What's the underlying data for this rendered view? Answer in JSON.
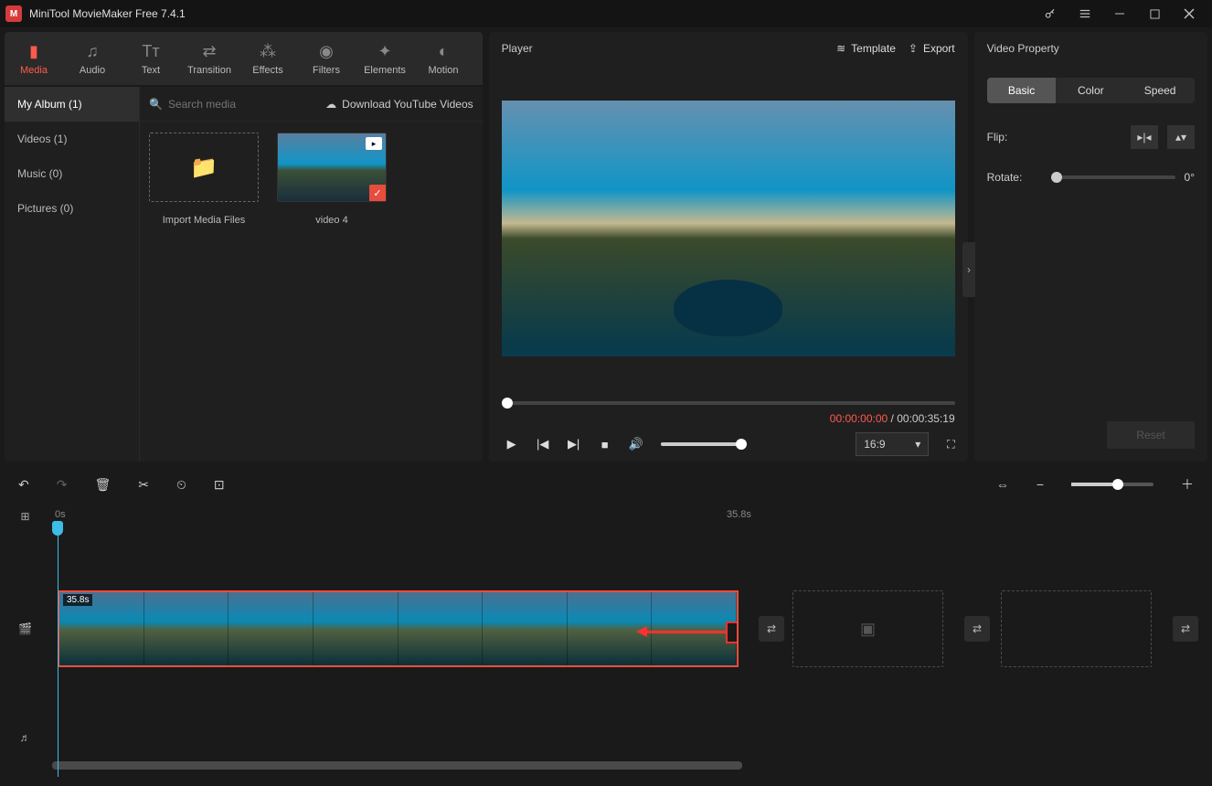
{
  "app": {
    "title": "MiniTool MovieMaker Free 7.4.1"
  },
  "toolbar_tabs": [
    {
      "label": "Media",
      "icon": "folder",
      "active": true
    },
    {
      "label": "Audio",
      "icon": "music"
    },
    {
      "label": "Text",
      "icon": "text"
    },
    {
      "label": "Transition",
      "icon": "swap"
    },
    {
      "label": "Effects",
      "icon": "sparkle"
    },
    {
      "label": "Filters",
      "icon": "filter"
    },
    {
      "label": "Elements",
      "icon": "star"
    },
    {
      "label": "Motion",
      "icon": "motion"
    }
  ],
  "album_sidebar": [
    {
      "label": "My Album (1)",
      "active": true
    },
    {
      "label": "Videos (1)"
    },
    {
      "label": "Music (0)"
    },
    {
      "label": "Pictures (0)"
    }
  ],
  "media_search": {
    "placeholder": "Search media",
    "download_label": "Download YouTube Videos"
  },
  "thumbs": {
    "import_label": "Import Media Files",
    "video1_label": "video 4"
  },
  "player": {
    "title": "Player",
    "template_label": "Template",
    "export_label": "Export",
    "current_time": "00:00:00:00",
    "separator": " / ",
    "total_time": "00:00:35:19",
    "aspect": "16:9"
  },
  "property": {
    "title": "Video Property",
    "tabs": {
      "basic": "Basic",
      "color": "Color",
      "speed": "Speed"
    },
    "flip_label": "Flip:",
    "rotate_label": "Rotate:",
    "rotate_value": "0°",
    "reset_label": "Reset"
  },
  "timeline": {
    "ruler_start": "0s",
    "ruler_mid": "35.8s",
    "clip_duration": "35.8s"
  }
}
